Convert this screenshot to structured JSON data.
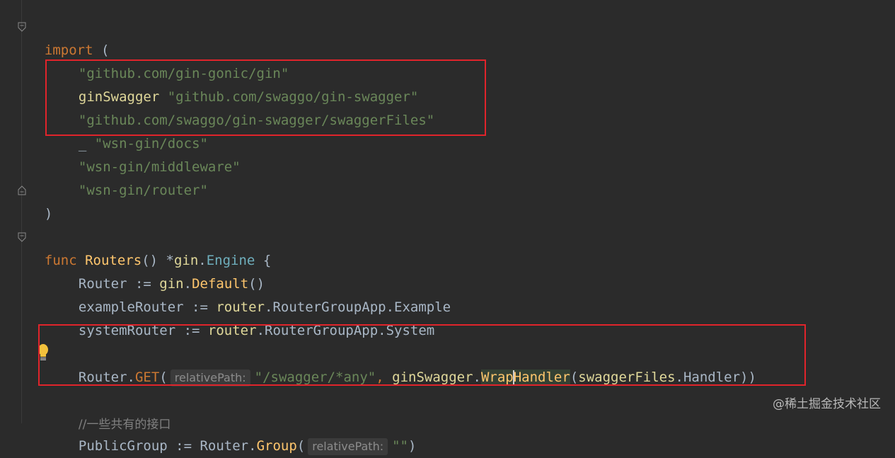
{
  "code": {
    "import_kw": "import",
    "open_paren": " (",
    "imports": {
      "gin": "\"github.com/gin-gonic/gin\"",
      "swagger_alias": "ginSwagger",
      "swagger_path": "\"github.com/swaggo/gin-swagger\"",
      "swagger_files": "\"github.com/swaggo/gin-swagger/swaggerFiles\"",
      "blank": "_",
      "docs": "\"wsn-gin/docs\"",
      "middleware": "\"wsn-gin/middleware\"",
      "router": "\"wsn-gin/router\""
    },
    "close_paren": ")",
    "func_line": {
      "kw": "func",
      "name": "Routers",
      "params": "() *",
      "pkg": "gin",
      "dot": ".",
      "type": "Engine",
      "brace": " {"
    },
    "router_line": {
      "var": "Router := ",
      "pkg": "gin",
      "dot": ".",
      "call": "Default",
      "parens": "()"
    },
    "example_line": {
      "var": "exampleRouter := ",
      "pkg": "router",
      "rest": ".RouterGroupApp.Example"
    },
    "system_line": {
      "var": "systemRouter := ",
      "pkg": "router",
      "rest": ".RouterGroupApp.System"
    },
    "get_line": {
      "obj": "Router.",
      "method": "GET",
      "open": "(",
      "hint": "relativePath:",
      "path": "\"/swagger/*any\"",
      "comma": ", ",
      "pkg": "ginSwagger",
      "dot": ".",
      "call_a": "Wrap",
      "call_b": "Handler",
      "arg_open": "(",
      "arg_pkg": "swaggerFiles",
      "arg_rest": ".Handler))"
    },
    "comment": "//一些共有的接口",
    "public_line": {
      "var": "PublicGroup := Router.",
      "call": "Group",
      "open": "(",
      "hint": "relativePath:",
      "arg": "\"\"",
      "close": ")"
    }
  },
  "watermark": "@稀土掘金技术社区"
}
